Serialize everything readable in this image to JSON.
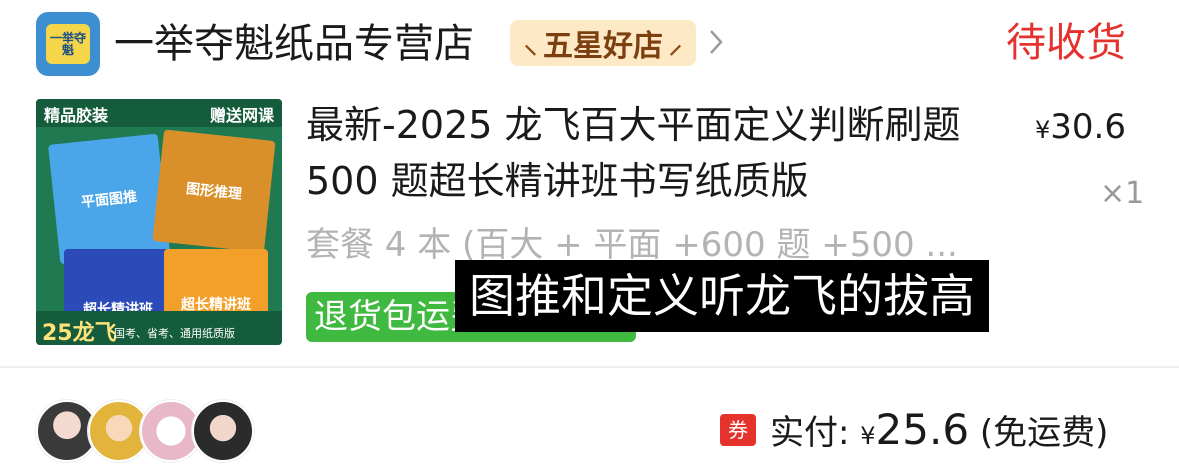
{
  "store": {
    "logo_text": "一举夺魁",
    "name": "一举夺魁纸品专营店",
    "badge": "五星好店",
    "order_status": "待收货"
  },
  "product": {
    "thumbnail": {
      "top_left": "精品胶装",
      "top_right": "赠送网课",
      "book1": "平面图推",
      "book2": "图形推理",
      "book3": "超长精讲班",
      "book4": "超长精讲班",
      "bottom_big": "25龙飞",
      "bottom_small": "国考、省考、通用纸质版"
    },
    "title": "最新-2025 龙飞百大平面定义判断刷题 500 题超长精讲班书写纸质版",
    "price_symbol": "¥",
    "price": "30.6",
    "quantity": "×1",
    "spec": "套餐 4 本 (百大 + 平面 +600 题 +500 ...",
    "return_tag": "退货包运费"
  },
  "subtitle_overlay": "图推和定义听龙飞的拔高",
  "payment": {
    "coupon_label": "券",
    "label": "实付: ",
    "currency": "¥",
    "amount": "25.6",
    "note": " (免运费)"
  },
  "colors": {
    "accent_red": "#e5322d",
    "badge_bg": "#fde9c6",
    "return_green": "#3fb93f"
  }
}
